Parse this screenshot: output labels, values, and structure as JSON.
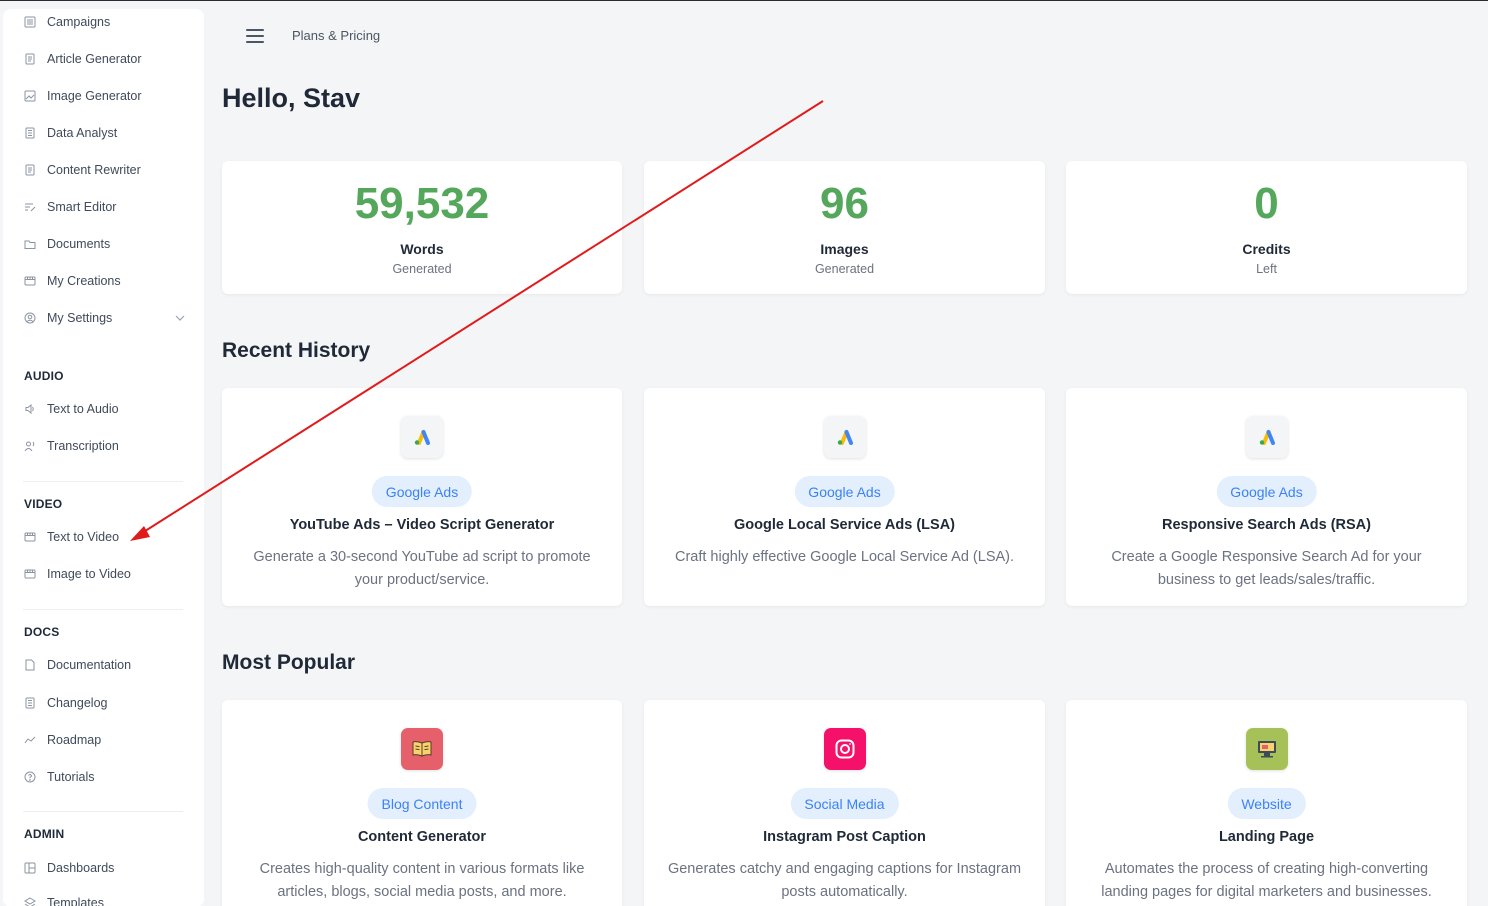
{
  "sidebar": {
    "items": [
      {
        "label": "Campaigns",
        "icon": "list-icon"
      },
      {
        "label": "Article Generator",
        "icon": "document-icon"
      },
      {
        "label": "Image Generator",
        "icon": "image-icon"
      },
      {
        "label": "Data Analyst",
        "icon": "report-icon"
      },
      {
        "label": "Content Rewriter",
        "icon": "document-icon"
      },
      {
        "label": "Smart Editor",
        "icon": "edit-icon"
      },
      {
        "label": "Documents",
        "icon": "folder-icon"
      },
      {
        "label": "My Creations",
        "icon": "film-icon"
      },
      {
        "label": "My Settings",
        "icon": "user-circle-icon"
      }
    ],
    "audio": {
      "title": "AUDIO",
      "items": [
        {
          "label": "Text to Audio",
          "icon": "speaker-icon"
        },
        {
          "label": "Transcription",
          "icon": "microphone-user-icon"
        }
      ]
    },
    "video": {
      "title": "VIDEO",
      "items": [
        {
          "label": "Text to Video",
          "icon": "film-icon"
        },
        {
          "label": "Image to Video",
          "icon": "film-icon"
        }
      ]
    },
    "docs": {
      "title": "DOCS",
      "items": [
        {
          "label": "Documentation",
          "icon": "document-icon"
        },
        {
          "label": "Changelog",
          "icon": "report-icon"
        },
        {
          "label": "Roadmap",
          "icon": "trend-icon"
        },
        {
          "label": "Tutorials",
          "icon": "question-circle-icon"
        }
      ]
    },
    "admin": {
      "title": "ADMIN",
      "items": [
        {
          "label": "Dashboards",
          "icon": "layout-icon"
        },
        {
          "label": "Templates",
          "icon": "layers-icon"
        }
      ]
    }
  },
  "header": {
    "breadcrumb": "Plans & Pricing"
  },
  "greeting": "Hello, Stav",
  "stats": [
    {
      "value": "59,532",
      "label": "Words",
      "sub": "Generated"
    },
    {
      "value": "96",
      "label": "Images",
      "sub": "Generated"
    },
    {
      "value": "0",
      "label": "Credits",
      "sub": "Left"
    }
  ],
  "recent": {
    "title": "Recent History",
    "cards": [
      {
        "badge": "Google Ads",
        "title": "YouTube Ads – Video Script Generator",
        "desc": "Generate a 30-second YouTube ad script to promote your product/service."
      },
      {
        "badge": "Google Ads",
        "title": "Google Local Service Ads (LSA)",
        "desc": "Craft highly effective Google Local Service Ad (LSA)."
      },
      {
        "badge": "Google Ads",
        "title": "Responsive Search Ads (RSA)",
        "desc": "Create a Google Responsive Search Ad for your business to get leads/sales/traffic."
      }
    ]
  },
  "popular": {
    "title": "Most Popular",
    "cards": [
      {
        "badge": "Blog Content",
        "title": "Content Generator",
        "desc": "Creates high-quality content in various formats like articles, blogs, social media posts, and more.",
        "icon_bg": "#e5606a"
      },
      {
        "badge": "Social Media",
        "title": "Instagram Post Caption",
        "desc": "Generates catchy and engaging captions for Instagram posts automatically.",
        "icon_bg": "#f5106a"
      },
      {
        "badge": "Website",
        "title": "Landing Page",
        "desc": "Automates the process of creating high-converting landing pages for digital marketers and businesses.",
        "icon_bg": "#a7c159"
      }
    ]
  },
  "colors": {
    "stat_green": "#54a75b",
    "badge_bg": "#e3effd",
    "badge_text": "#3b82f6",
    "annotation_arrow": "#e01b1b"
  }
}
